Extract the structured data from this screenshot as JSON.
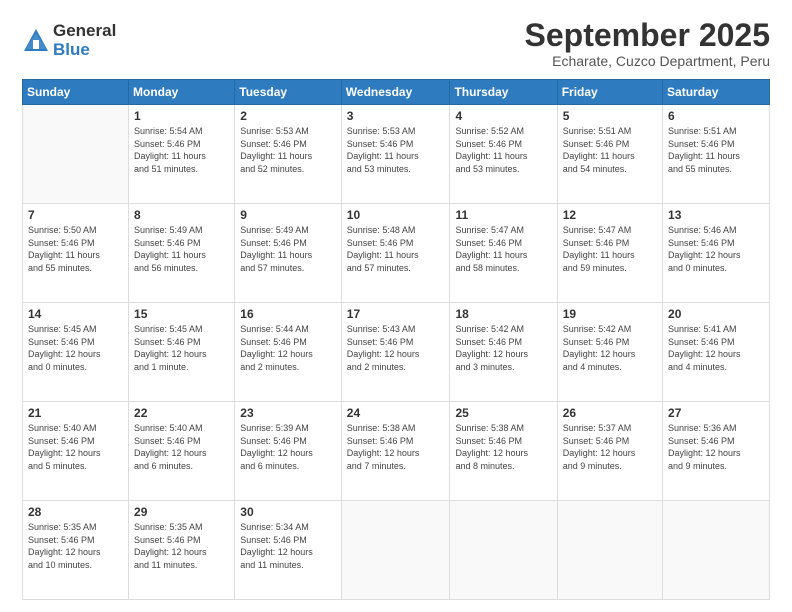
{
  "logo": {
    "general": "General",
    "blue": "Blue"
  },
  "header": {
    "month": "September 2025",
    "location": "Echarate, Cuzco Department, Peru"
  },
  "days_of_week": [
    "Sunday",
    "Monday",
    "Tuesday",
    "Wednesday",
    "Thursday",
    "Friday",
    "Saturday"
  ],
  "weeks": [
    [
      {
        "day": "",
        "info": ""
      },
      {
        "day": "1",
        "info": "Sunrise: 5:54 AM\nSunset: 5:46 PM\nDaylight: 11 hours\nand 51 minutes."
      },
      {
        "day": "2",
        "info": "Sunrise: 5:53 AM\nSunset: 5:46 PM\nDaylight: 11 hours\nand 52 minutes."
      },
      {
        "day": "3",
        "info": "Sunrise: 5:53 AM\nSunset: 5:46 PM\nDaylight: 11 hours\nand 53 minutes."
      },
      {
        "day": "4",
        "info": "Sunrise: 5:52 AM\nSunset: 5:46 PM\nDaylight: 11 hours\nand 53 minutes."
      },
      {
        "day": "5",
        "info": "Sunrise: 5:51 AM\nSunset: 5:46 PM\nDaylight: 11 hours\nand 54 minutes."
      },
      {
        "day": "6",
        "info": "Sunrise: 5:51 AM\nSunset: 5:46 PM\nDaylight: 11 hours\nand 55 minutes."
      }
    ],
    [
      {
        "day": "7",
        "info": "Sunrise: 5:50 AM\nSunset: 5:46 PM\nDaylight: 11 hours\nand 55 minutes."
      },
      {
        "day": "8",
        "info": "Sunrise: 5:49 AM\nSunset: 5:46 PM\nDaylight: 11 hours\nand 56 minutes."
      },
      {
        "day": "9",
        "info": "Sunrise: 5:49 AM\nSunset: 5:46 PM\nDaylight: 11 hours\nand 57 minutes."
      },
      {
        "day": "10",
        "info": "Sunrise: 5:48 AM\nSunset: 5:46 PM\nDaylight: 11 hours\nand 57 minutes."
      },
      {
        "day": "11",
        "info": "Sunrise: 5:47 AM\nSunset: 5:46 PM\nDaylight: 11 hours\nand 58 minutes."
      },
      {
        "day": "12",
        "info": "Sunrise: 5:47 AM\nSunset: 5:46 PM\nDaylight: 11 hours\nand 59 minutes."
      },
      {
        "day": "13",
        "info": "Sunrise: 5:46 AM\nSunset: 5:46 PM\nDaylight: 12 hours\nand 0 minutes."
      }
    ],
    [
      {
        "day": "14",
        "info": "Sunrise: 5:45 AM\nSunset: 5:46 PM\nDaylight: 12 hours\nand 0 minutes."
      },
      {
        "day": "15",
        "info": "Sunrise: 5:45 AM\nSunset: 5:46 PM\nDaylight: 12 hours\nand 1 minute."
      },
      {
        "day": "16",
        "info": "Sunrise: 5:44 AM\nSunset: 5:46 PM\nDaylight: 12 hours\nand 2 minutes."
      },
      {
        "day": "17",
        "info": "Sunrise: 5:43 AM\nSunset: 5:46 PM\nDaylight: 12 hours\nand 2 minutes."
      },
      {
        "day": "18",
        "info": "Sunrise: 5:42 AM\nSunset: 5:46 PM\nDaylight: 12 hours\nand 3 minutes."
      },
      {
        "day": "19",
        "info": "Sunrise: 5:42 AM\nSunset: 5:46 PM\nDaylight: 12 hours\nand 4 minutes."
      },
      {
        "day": "20",
        "info": "Sunrise: 5:41 AM\nSunset: 5:46 PM\nDaylight: 12 hours\nand 4 minutes."
      }
    ],
    [
      {
        "day": "21",
        "info": "Sunrise: 5:40 AM\nSunset: 5:46 PM\nDaylight: 12 hours\nand 5 minutes."
      },
      {
        "day": "22",
        "info": "Sunrise: 5:40 AM\nSunset: 5:46 PM\nDaylight: 12 hours\nand 6 minutes."
      },
      {
        "day": "23",
        "info": "Sunrise: 5:39 AM\nSunset: 5:46 PM\nDaylight: 12 hours\nand 6 minutes."
      },
      {
        "day": "24",
        "info": "Sunrise: 5:38 AM\nSunset: 5:46 PM\nDaylight: 12 hours\nand 7 minutes."
      },
      {
        "day": "25",
        "info": "Sunrise: 5:38 AM\nSunset: 5:46 PM\nDaylight: 12 hours\nand 8 minutes."
      },
      {
        "day": "26",
        "info": "Sunrise: 5:37 AM\nSunset: 5:46 PM\nDaylight: 12 hours\nand 9 minutes."
      },
      {
        "day": "27",
        "info": "Sunrise: 5:36 AM\nSunset: 5:46 PM\nDaylight: 12 hours\nand 9 minutes."
      }
    ],
    [
      {
        "day": "28",
        "info": "Sunrise: 5:35 AM\nSunset: 5:46 PM\nDaylight: 12 hours\nand 10 minutes."
      },
      {
        "day": "29",
        "info": "Sunrise: 5:35 AM\nSunset: 5:46 PM\nDaylight: 12 hours\nand 11 minutes."
      },
      {
        "day": "30",
        "info": "Sunrise: 5:34 AM\nSunset: 5:46 PM\nDaylight: 12 hours\nand 11 minutes."
      },
      {
        "day": "",
        "info": ""
      },
      {
        "day": "",
        "info": ""
      },
      {
        "day": "",
        "info": ""
      },
      {
        "day": "",
        "info": ""
      }
    ]
  ]
}
